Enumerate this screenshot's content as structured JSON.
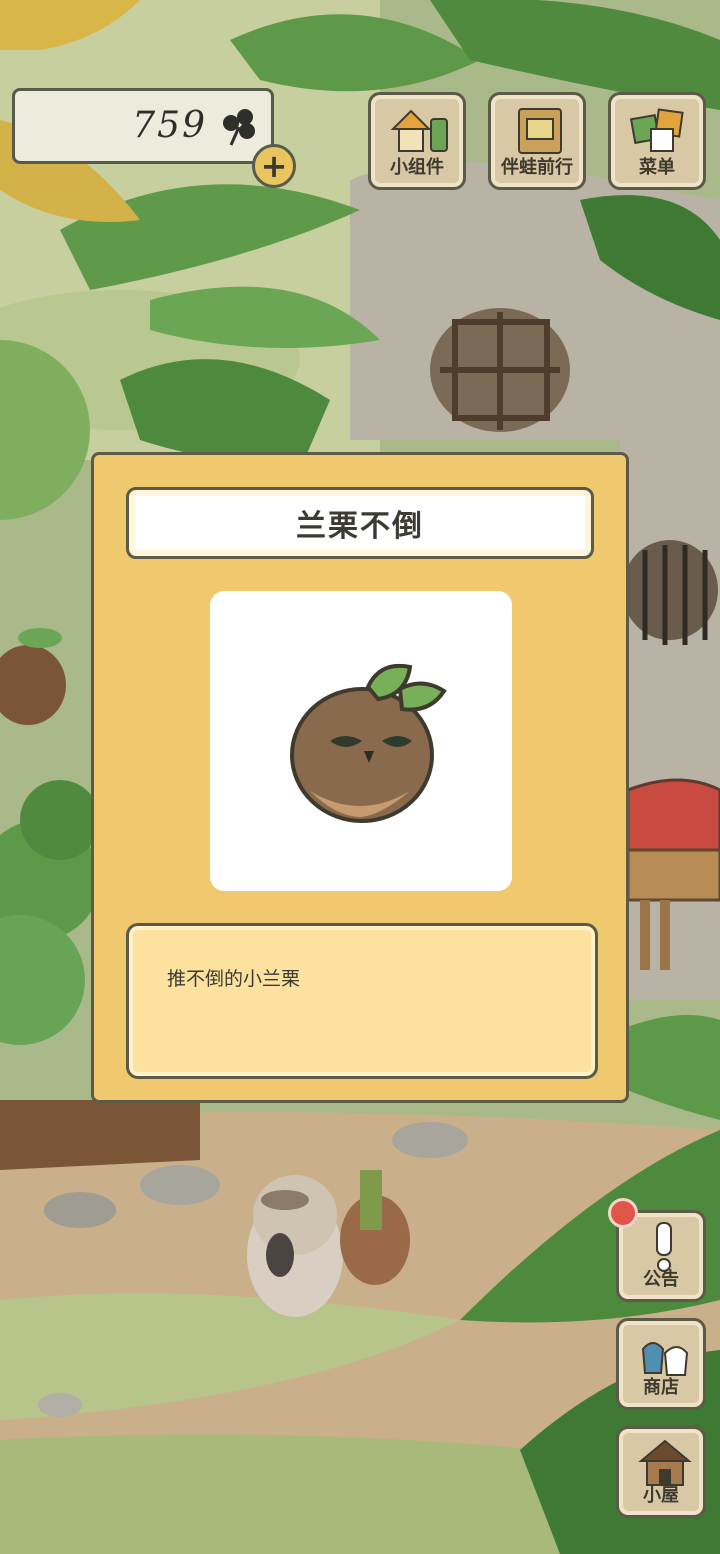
{
  "hud": {
    "clover_count": "759",
    "clover_icon": "clover-icon",
    "add_icon": "plus-icon"
  },
  "top_menu": {
    "widgets_label": "小组件",
    "travel_label": "伴蛙前行",
    "menu_label": "菜单"
  },
  "side_menu": {
    "notice_label": "公告",
    "shop_label": "商店",
    "house_label": "小屋"
  },
  "dialog": {
    "title": "兰栗不倒",
    "description": "推不倒的小兰栗",
    "item_icon": "chestnut-sprout-icon"
  },
  "colors": {
    "dialog_bg": "#f0c96e",
    "desc_bg": "#fde19e",
    "notification": "#e0554a"
  }
}
